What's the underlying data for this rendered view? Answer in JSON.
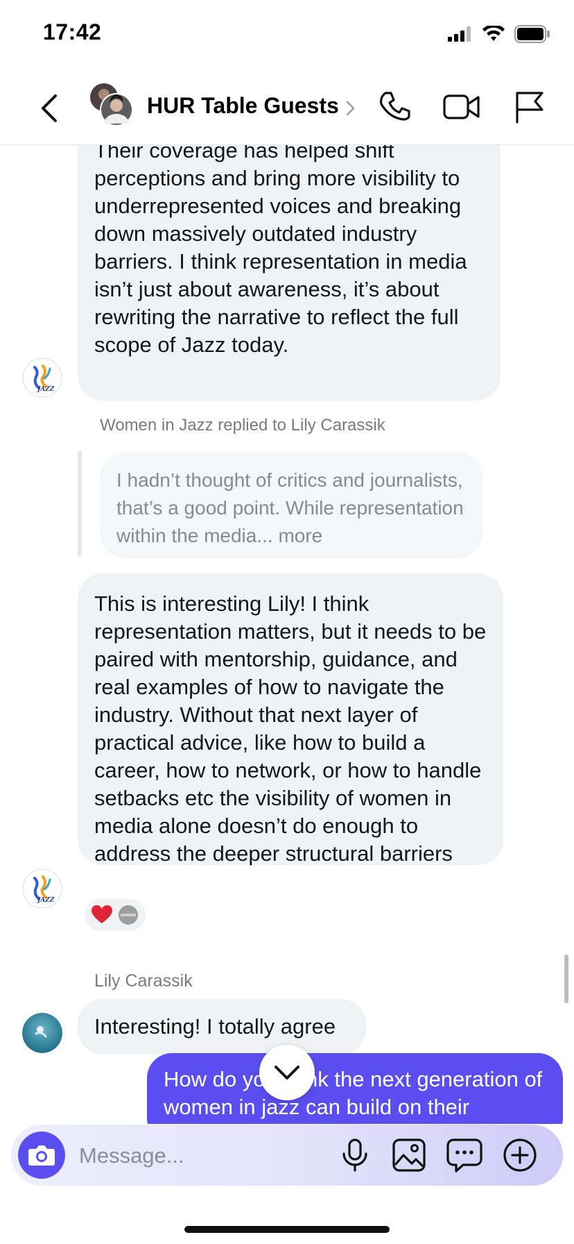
{
  "status_bar": {
    "time": "17:42"
  },
  "header": {
    "group_name": "HUR Table Guests"
  },
  "messages": {
    "first": {
      "text": "Their coverage has helped shift perceptions and bring more visibility to underrepresented voices and breaking down massively outdated industry barriers. I think representation in media isn’t just about awareness, it’s about rewriting the narrative to reflect the full scope of Jazz today."
    },
    "reply_note": "Women in Jazz replied to Lily Carassik",
    "quote": "I hadn’t thought of critics and journalists, that’s a good point. While representation within the media... more",
    "second": {
      "text": "This is interesting Lily! I think representation matters, but it needs to be paired with mentorship, guidance, and real examples of how to navigate the industry. Without that next layer of practical advice, like how to build a career, how to network, or how to handle setbacks etc the visibility of women in media alone doesn’t do enough to address the deeper structural barriers"
    },
    "reactions": [
      "❤️"
    ],
    "third": {
      "sender": "Lily Carassik",
      "text": "Interesting! I totally agree"
    },
    "sent": {
      "text": "How do you think the next generation of women in jazz can build on their"
    }
  },
  "composer": {
    "placeholder": "Message..."
  },
  "icons": {
    "back": "chevron-left-icon",
    "phone": "phone-icon",
    "video": "video-camera-icon",
    "flag": "flag-icon",
    "camera": "camera-icon",
    "mic": "microphone-icon",
    "gallery": "image-icon",
    "sticker": "chat-bubble-icon",
    "plus": "plus-circle-icon"
  },
  "colors": {
    "accent": "#5b4ef0",
    "bubble_gray": "#f1f2f4"
  }
}
